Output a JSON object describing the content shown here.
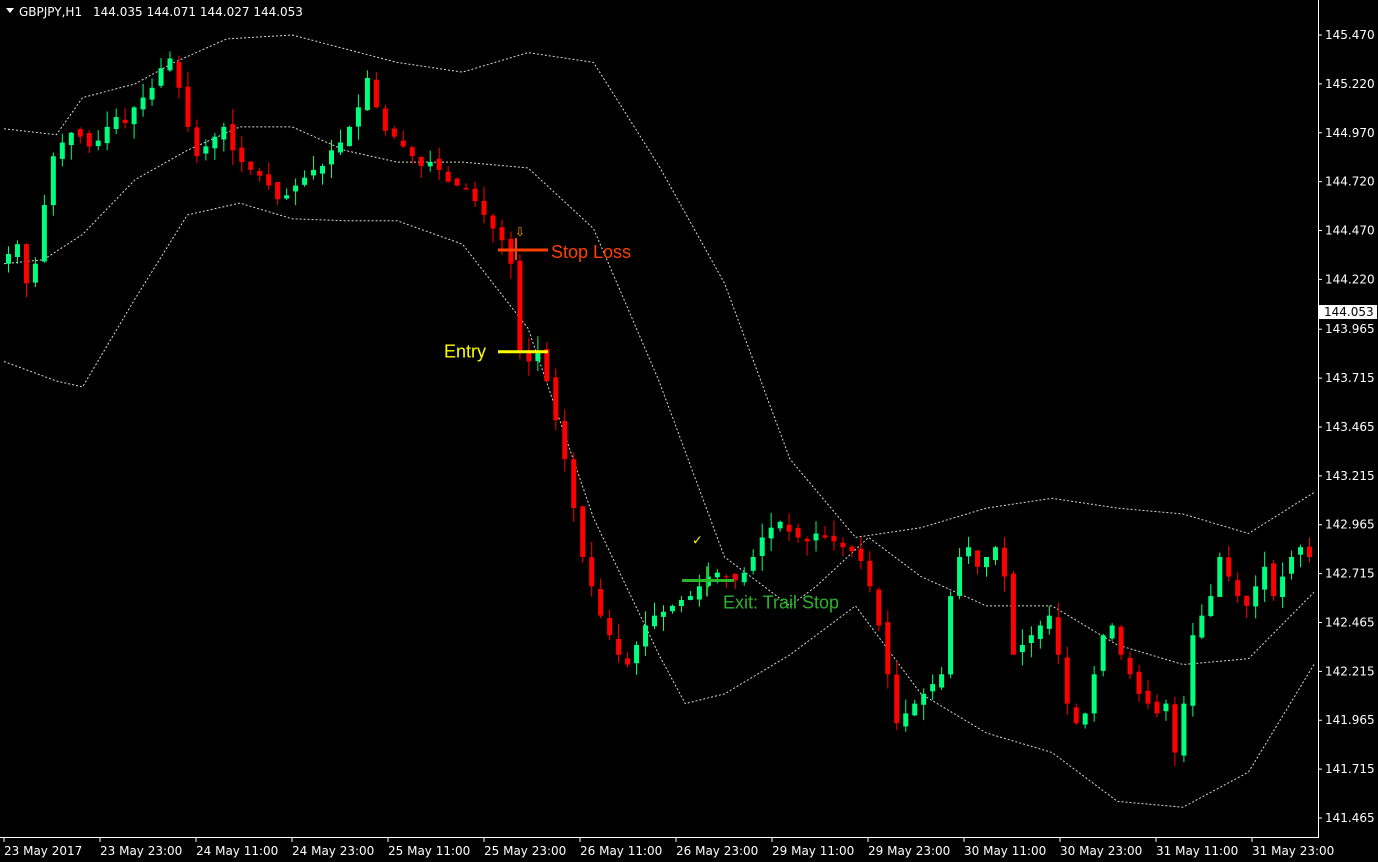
{
  "header": {
    "symbol": "GBPJPY,H1",
    "ohlc": "144.035 144.071 144.027 144.053"
  },
  "chart_data": {
    "type": "candlestick",
    "symbol": "GBPJPY",
    "timeframe": "H1",
    "ylim": [
      141.4,
      145.55
    ],
    "price_ticks": [
      "145.470",
      "145.220",
      "144.970",
      "144.720",
      "144.470",
      "144.220",
      "143.965",
      "143.715",
      "143.465",
      "143.215",
      "142.965",
      "142.715",
      "142.465",
      "142.215",
      "141.965",
      "141.715",
      "141.465"
    ],
    "current_price": "144.053",
    "time_labels": [
      "23 May 2017",
      "23 May 23:00",
      "24 May 11:00",
      "24 May 23:00",
      "25 May 11:00",
      "25 May 23:00",
      "26 May 11:00",
      "26 May 23:00",
      "29 May 11:00",
      "29 May 23:00",
      "30 May 11:00",
      "30 May 23:00",
      "31 May 11:00",
      "31 May 23:00"
    ],
    "close_path": [
      144.35,
      144.4,
      144.2,
      144.3,
      144.6,
      144.85,
      144.92,
      144.97,
      144.95,
      144.9,
      144.93,
      145.0,
      145.05,
      145.02,
      145.1,
      145.15,
      145.2,
      145.3,
      145.35,
      145.2,
      145.0,
      144.85,
      144.9,
      144.95,
      145.0,
      144.88,
      144.82,
      144.78,
      144.75,
      144.7,
      144.63,
      144.65,
      144.7,
      144.74,
      144.78,
      144.8,
      144.88,
      144.92,
      145.0,
      145.1,
      145.25,
      145.1,
      144.98,
      144.95,
      144.9,
      144.85,
      144.8,
      144.82,
      144.78,
      144.72,
      144.7,
      144.68,
      144.62,
      144.55,
      144.48,
      144.42,
      144.3,
      143.85,
      143.8,
      143.85,
      143.7,
      143.5,
      143.3,
      143.05,
      142.8,
      142.65,
      142.5,
      142.4,
      142.3,
      142.25,
      142.35,
      142.45,
      142.5,
      142.52,
      142.55,
      142.58,
      142.6,
      142.65,
      142.7,
      142.72,
      142.7,
      142.68,
      142.72,
      142.8,
      142.9,
      142.95,
      142.98,
      142.93,
      142.9,
      142.88,
      142.92,
      142.9,
      142.88,
      142.85,
      142.83,
      142.78,
      142.65,
      142.45,
      142.2,
      141.95,
      142.0,
      142.05,
      142.1,
      142.15,
      142.2,
      142.6,
      142.8,
      142.85,
      142.75,
      142.8,
      142.85,
      142.7,
      142.3,
      142.35,
      142.4,
      142.45,
      142.5,
      142.3,
      142.05,
      141.95,
      142.0,
      142.2,
      142.4,
      142.45,
      142.3,
      142.2,
      142.1,
      142.05,
      142.0,
      142.05,
      141.8,
      142.05,
      142.4,
      142.5,
      142.6,
      142.8,
      142.7,
      142.6,
      142.55,
      142.65,
      142.75,
      142.6,
      142.7,
      142.8,
      142.85,
      142.8
    ],
    "bands": {
      "upper": [
        [
          0,
          144.99
        ],
        [
          0.04,
          144.96
        ],
        [
          0.06,
          145.15
        ],
        [
          0.1,
          145.22
        ],
        [
          0.13,
          145.33
        ],
        [
          0.17,
          145.45
        ],
        [
          0.22,
          145.47
        ],
        [
          0.3,
          145.33
        ],
        [
          0.35,
          145.28
        ],
        [
          0.4,
          145.38
        ],
        [
          0.45,
          145.33
        ],
        [
          0.5,
          144.8
        ],
        [
          0.55,
          144.2
        ],
        [
          0.6,
          143.3
        ],
        [
          0.65,
          142.9
        ],
        [
          0.7,
          142.95
        ],
        [
          0.75,
          143.05
        ],
        [
          0.8,
          143.1
        ],
        [
          0.85,
          143.05
        ],
        [
          0.9,
          143.02
        ],
        [
          0.95,
          142.92
        ],
        [
          1.0,
          143.13
        ]
      ],
      "middle": [
        [
          0,
          144.3
        ],
        [
          0.03,
          144.32
        ],
        [
          0.06,
          144.45
        ],
        [
          0.1,
          144.73
        ],
        [
          0.14,
          144.88
        ],
        [
          0.18,
          145.0
        ],
        [
          0.22,
          145.0
        ],
        [
          0.26,
          144.88
        ],
        [
          0.3,
          144.82
        ],
        [
          0.35,
          144.82
        ],
        [
          0.4,
          144.79
        ],
        [
          0.45,
          144.48
        ],
        [
          0.5,
          143.7
        ],
        [
          0.55,
          142.8
        ],
        [
          0.6,
          142.55
        ],
        [
          0.62,
          142.65
        ],
        [
          0.66,
          142.9
        ],
        [
          0.7,
          142.7
        ],
        [
          0.75,
          142.55
        ],
        [
          0.8,
          142.55
        ],
        [
          0.85,
          142.35
        ],
        [
          0.9,
          142.25
        ],
        [
          0.95,
          142.28
        ],
        [
          1.0,
          142.62
        ]
      ],
      "lower": [
        [
          0,
          143.8
        ],
        [
          0.04,
          143.7
        ],
        [
          0.06,
          143.67
        ],
        [
          0.1,
          144.12
        ],
        [
          0.14,
          144.55
        ],
        [
          0.18,
          144.61
        ],
        [
          0.22,
          144.53
        ],
        [
          0.26,
          144.52
        ],
        [
          0.3,
          144.52
        ],
        [
          0.35,
          144.4
        ],
        [
          0.4,
          143.97
        ],
        [
          0.45,
          143.0
        ],
        [
          0.5,
          142.3
        ],
        [
          0.52,
          142.05
        ],
        [
          0.55,
          142.1
        ],
        [
          0.6,
          142.3
        ],
        [
          0.65,
          142.55
        ],
        [
          0.7,
          142.1
        ],
        [
          0.75,
          141.9
        ],
        [
          0.8,
          141.8
        ],
        [
          0.85,
          141.55
        ],
        [
          0.9,
          141.52
        ],
        [
          0.95,
          141.7
        ],
        [
          1.0,
          142.25
        ]
      ]
    },
    "annotations": {
      "stop_loss": {
        "label": "Stop Loss",
        "price": 144.37,
        "color": "#ff4000"
      },
      "entry": {
        "label": "Entry",
        "price": 143.85,
        "color": "#ffff00"
      },
      "exit": {
        "label": "Exit: Trail Stop",
        "price": 142.68,
        "color": "#2bb52b"
      },
      "sell_arrow_color": "#ffa500",
      "check_color": "#ffff00"
    },
    "colors": {
      "background": "#000000",
      "bull": "#00ff7f",
      "bear": "#ff0000",
      "bands": "#ffffff",
      "axis": "#ffffff"
    }
  }
}
